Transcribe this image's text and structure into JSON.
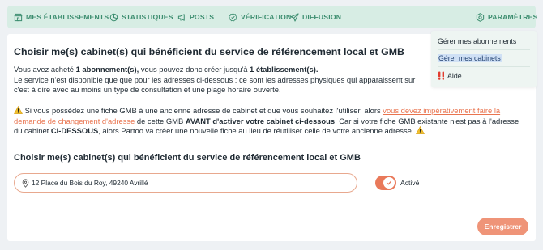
{
  "nav": {
    "etablissements": "MES ÉTABLISSEMENTS",
    "statistiques": "STATISTIQUES",
    "posts": "POSTS",
    "verification": "VÉRIFICATION",
    "diffusion": "DIFFUSION",
    "parametres": "PARAMÈTRES",
    "icons": [
      "store-icon",
      "chart-icon",
      "megaphone-icon",
      "badge-check-icon",
      "send-icon",
      "settings-icon"
    ]
  },
  "dropdown": {
    "item1": "Gérer mes abonnements",
    "item2": "Gérer mes cabinets",
    "item3": "Aide",
    "help_icon": "exclamation-icon"
  },
  "main": {
    "title": "Choisir me(s) cabinet(s) qui bénéficient du service de référencement local et GMB",
    "p1_a": "Vous avez acheté ",
    "p1_b": "1 abonnement(s),",
    "p1_c": " vous pouvez donc créer jusqu'à ",
    "p1_d": "1 établissement(s).",
    "p1_e": "Le service n'est disponible que que pour les adresses ci-dessous : ce sont les adresses physiques qui apparaissent sur",
    "p1_f": "c'est à dire avec au moins un type de consultation et une plage horaire ouverte.",
    "p2_a": " Si vous possédez une fiche GMB à une ancienne adresse de cabinet et que vous souhaitez l'utiliser, alors ",
    "p2_link": "vous devez impérativement faire la demande de changement d'adresse",
    "p2_b": " de cette GMB ",
    "p2_c": "AVANT d'activer votre cabinet ci-dessous",
    "p2_d": ". Car si votre fiche GMB existante n'est pas à l'adresse du cabinet ",
    "p2_e": "CI-DESSOUS",
    "p2_f": ", alors Partoo va créer une nouvelle fiche au lieu de réutiliser celle de votre ancienne adresse. ",
    "subtitle": "Choisir me(s) cabinet(s) qui bénéficient du service de référencement local et GMB",
    "address": "12 Place du Bois du Roy, 49240 Avrillé",
    "toggle_label": "Activé",
    "toggle_on": true,
    "save_button": "Enregistrer",
    "colors": {
      "accent": "#e9795a",
      "nav_text": "#3c8d6f",
      "nav_bg": "#d7ede4"
    }
  }
}
